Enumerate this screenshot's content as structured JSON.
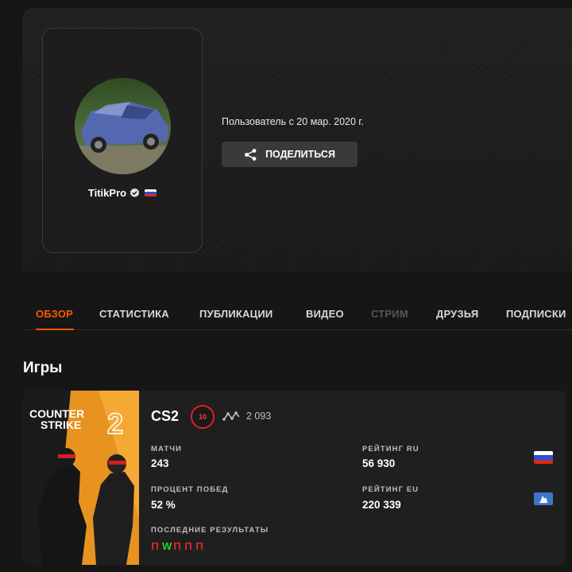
{
  "profile": {
    "username": "TitikPro",
    "member_since": "Пользователь с 20 мар. 2020 г.",
    "share_label": "ПОДЕЛИТЬСЯ"
  },
  "tabs": [
    {
      "label": "ОБЗОР",
      "state": "active"
    },
    {
      "label": "СТАТИСТИКА",
      "state": "normal"
    },
    {
      "label": "ПУБЛИКАЦИИ",
      "state": "normal"
    },
    {
      "label": "ВИДЕО",
      "state": "normal"
    },
    {
      "label": "СТРИМ",
      "state": "disabled"
    },
    {
      "label": "ДРУЗЬЯ",
      "state": "normal"
    },
    {
      "label": "ПОДПИСКИ",
      "state": "normal"
    }
  ],
  "games_section": {
    "title": "Игры",
    "card": {
      "cover_text_line1": "COUNTER",
      "cover_text_line2": "STRIKE",
      "cover_number": "2",
      "game": "CS2",
      "level": "10",
      "elo": "2 093",
      "matches_label": "МАТЧИ",
      "matches_value": "243",
      "winrate_label": "ПРОЦЕНТ ПОБЕД",
      "winrate_value": "52 %",
      "rating_ru_label": "РЕЙТИНГ RU",
      "rating_ru_value": "56 930",
      "rating_eu_label": "РЕЙТИНГ EU",
      "rating_eu_value": "220 339",
      "recent_label": "ПОСЛЕДНИЕ РЕЗУЛЬТАТЫ",
      "recent_results": [
        "П",
        "W",
        "П",
        "П",
        "П"
      ]
    }
  },
  "colors": {
    "accent": "#ff5500",
    "win": "#32c832",
    "loss": "#e02828",
    "level_ring": "#e02020"
  },
  "icons": {
    "verified": "verified-check-icon",
    "share": "share-icon",
    "elo": "elo-graph-icon",
    "flag_ru": "russia-flag-icon",
    "eu_region": "eu-region-icon"
  }
}
